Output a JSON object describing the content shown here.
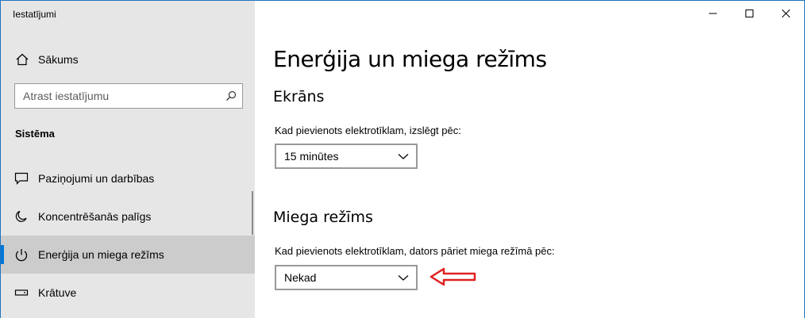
{
  "window": {
    "title": "Iestatījumi",
    "minimize_icon": "minimize-icon",
    "maximize_icon": "maximize-icon",
    "close_icon": "close-icon"
  },
  "sidebar": {
    "home_label": "Sākums",
    "search_placeholder": "Atrast iestatījumu",
    "section_title": "Sistēma",
    "items": [
      {
        "label": "Paziņojumi un darbības",
        "icon": "notification-icon"
      },
      {
        "label": "Koncentrēšanās palīgs",
        "icon": "moon-icon"
      },
      {
        "label": "Enerģija un miega režīms",
        "icon": "power-icon",
        "selected": true
      },
      {
        "label": "Krātuve",
        "icon": "storage-icon"
      }
    ]
  },
  "main": {
    "title": "Enerģija un miega režīms",
    "screen": {
      "heading": "Ekrāns",
      "label": "Kad pievienots elektrotīklam, izslēgt pēc:",
      "value": "15 minūtes"
    },
    "sleep": {
      "heading": "Miega režīms",
      "label": "Kad pievienots elektrotīklam, dators pāriet miega režīmā pēc:",
      "value": "Nekad"
    }
  },
  "colors": {
    "accent": "#0078d7",
    "sidebar_bg": "#e6e6e6",
    "selected_bg": "#cccccc",
    "annotation_arrow": "#e02020"
  }
}
